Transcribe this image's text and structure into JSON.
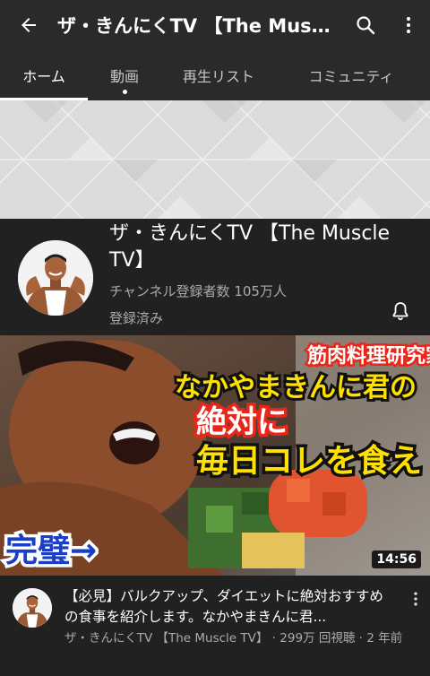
{
  "app_bar": {
    "title": "ザ・きんにくTV 【The Muscle TV】",
    "back_icon": "arrow-left-icon",
    "search_icon": "search-icon",
    "more_icon": "more-vertical-icon"
  },
  "tabs": [
    {
      "label": "ホーム",
      "active": true
    },
    {
      "label": "動画",
      "active": false,
      "has_new_dot": true
    },
    {
      "label": "再生リスト",
      "active": false
    },
    {
      "label": "コミュニティ",
      "active": false
    }
  ],
  "channel": {
    "name": "ザ・きんにくTV 【The Muscle TV】",
    "subscribers": "チャンネル登録者数 105万人",
    "subscribed_label": "登録済み",
    "bell_icon": "bell-icon"
  },
  "video": {
    "thumbnail": {
      "caption_top": "筋肉料理研究家",
      "caption_line2": "なかやまきんに君の",
      "caption_line3": "絶対に",
      "caption_line4": "毎日コレを食え",
      "caption_bottom": "完璧→"
    },
    "duration": "14:56",
    "title": "【必見】バルクアップ、ダイエットに絶対おすすめの食事を紹介します。なかやまきんに君...",
    "meta": "ザ・きんにくTV 【The Muscle TV】 · 299万 回視聴 · 2 年前"
  },
  "colors": {
    "background": "#212121",
    "app_bar": "#2a2a2a",
    "caption_yellow": "#ffe100",
    "caption_red": "#e8261a",
    "caption_blue": "#1a3fc4"
  }
}
